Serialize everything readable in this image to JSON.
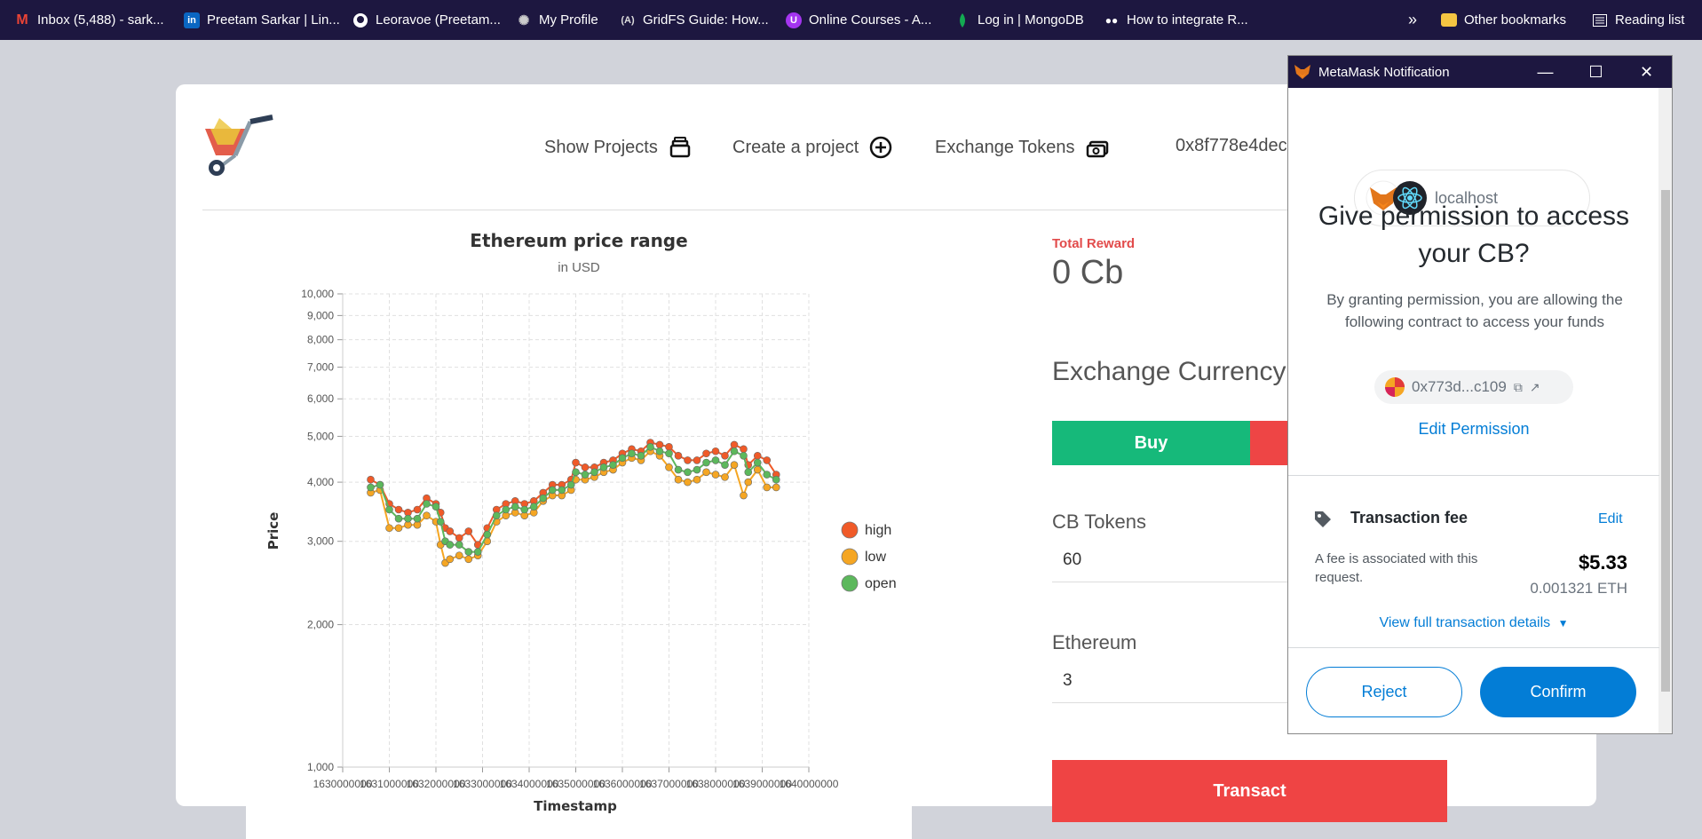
{
  "bookmarks": {
    "items": [
      {
        "label": "Inbox (5,488) - sark...",
        "icon": "gmail-icon",
        "color": "#ea4335"
      },
      {
        "label": "Preetam Sarkar | Lin...",
        "icon": "linkedin-icon",
        "color": "#0a66c2"
      },
      {
        "label": "Leoravoe (Preetam...",
        "icon": "github-icon",
        "color": "#ffffff"
      },
      {
        "label": "My Profile",
        "icon": "profile-icon",
        "color": "#cccccc"
      },
      {
        "label": "GridFS Guide: How...",
        "icon": "gridfs-icon",
        "color": "#dddddd"
      },
      {
        "label": "Online Courses - A...",
        "icon": "udemy-icon",
        "color": "#a435f0"
      },
      {
        "label": "Log in | MongoDB",
        "icon": "mongodb-leaf-icon",
        "color": "#13aa52"
      },
      {
        "label": "How to integrate R...",
        "icon": "medium-icon",
        "color": "#ffffff"
      }
    ],
    "overflow": "»",
    "other_bookmarks": "Other bookmarks",
    "reading_list": "Reading list"
  },
  "nav": {
    "show_projects": "Show Projects",
    "create_project": "Create a project",
    "exchange_tokens": "Exchange Tokens",
    "account": "0x8f778e4dec"
  },
  "chart_data": {
    "type": "line",
    "title": "Ethereum price range",
    "subtitle": "in USD",
    "xlabel": "Timestamp",
    "ylabel": "Price",
    "yscale": "log",
    "ylim": [
      1000,
      10000
    ],
    "xlim": [
      1630000000,
      1640000000
    ],
    "y_ticks": [
      "1,000",
      "2,000",
      "3,000",
      "4,000",
      "5,000",
      "6,000",
      "7,000",
      "8,000",
      "9,000",
      "10,000"
    ],
    "x_ticks": [
      "1630000000",
      "1631000000",
      "1632000000",
      "1633000000",
      "1634000000",
      "1635000000",
      "1636000000",
      "1637000000",
      "1638000000",
      "1639000000",
      "1640000000"
    ],
    "legend_position": "right",
    "grid": true,
    "series": [
      {
        "name": "high",
        "color": "#f05a28",
        "values": [
          [
            1630600000,
            4050
          ],
          [
            1630800000,
            3950
          ],
          [
            1631000000,
            3600
          ],
          [
            1631200000,
            3500
          ],
          [
            1631400000,
            3450
          ],
          [
            1631600000,
            3500
          ],
          [
            1631800000,
            3700
          ],
          [
            1632000000,
            3600
          ],
          [
            1632100000,
            3450
          ],
          [
            1632200000,
            3200
          ],
          [
            1632300000,
            3150
          ],
          [
            1632500000,
            3050
          ],
          [
            1632700000,
            3150
          ],
          [
            1632900000,
            2950
          ],
          [
            1633100000,
            3200
          ],
          [
            1633300000,
            3500
          ],
          [
            1633500000,
            3600
          ],
          [
            1633700000,
            3650
          ],
          [
            1633900000,
            3600
          ],
          [
            1634100000,
            3650
          ],
          [
            1634300000,
            3800
          ],
          [
            1634500000,
            3950
          ],
          [
            1634700000,
            3950
          ],
          [
            1634900000,
            4050
          ],
          [
            1635000000,
            4400
          ],
          [
            1635200000,
            4300
          ],
          [
            1635400000,
            4300
          ],
          [
            1635600000,
            4400
          ],
          [
            1635800000,
            4450
          ],
          [
            1636000000,
            4600
          ],
          [
            1636200000,
            4700
          ],
          [
            1636400000,
            4650
          ],
          [
            1636600000,
            4850
          ],
          [
            1636800000,
            4800
          ],
          [
            1637000000,
            4750
          ],
          [
            1637200000,
            4550
          ],
          [
            1637400000,
            4450
          ],
          [
            1637600000,
            4450
          ],
          [
            1637800000,
            4600
          ],
          [
            1638000000,
            4650
          ],
          [
            1638200000,
            4550
          ],
          [
            1638400000,
            4800
          ],
          [
            1638600000,
            4700
          ],
          [
            1638700000,
            4350
          ],
          [
            1638900000,
            4550
          ],
          [
            1639100000,
            4450
          ],
          [
            1639300000,
            4150
          ]
        ]
      },
      {
        "name": "low",
        "color": "#f5a623",
        "values": [
          [
            1630600000,
            3800
          ],
          [
            1630800000,
            3850
          ],
          [
            1631000000,
            3200
          ],
          [
            1631200000,
            3200
          ],
          [
            1631400000,
            3250
          ],
          [
            1631600000,
            3250
          ],
          [
            1631800000,
            3400
          ],
          [
            1632000000,
            3300
          ],
          [
            1632100000,
            2950
          ],
          [
            1632200000,
            2700
          ],
          [
            1632300000,
            2750
          ],
          [
            1632500000,
            2800
          ],
          [
            1632700000,
            2750
          ],
          [
            1632900000,
            2800
          ],
          [
            1633100000,
            3000
          ],
          [
            1633300000,
            3300
          ],
          [
            1633500000,
            3400
          ],
          [
            1633700000,
            3450
          ],
          [
            1633900000,
            3400
          ],
          [
            1634100000,
            3450
          ],
          [
            1634300000,
            3650
          ],
          [
            1634500000,
            3750
          ],
          [
            1634700000,
            3750
          ],
          [
            1634900000,
            3850
          ],
          [
            1635000000,
            4050
          ],
          [
            1635200000,
            4050
          ],
          [
            1635400000,
            4100
          ],
          [
            1635600000,
            4200
          ],
          [
            1635800000,
            4250
          ],
          [
            1636000000,
            4400
          ],
          [
            1636200000,
            4500
          ],
          [
            1636400000,
            4450
          ],
          [
            1636600000,
            4650
          ],
          [
            1636800000,
            4550
          ],
          [
            1637000000,
            4300
          ],
          [
            1637200000,
            4050
          ],
          [
            1637400000,
            4000
          ],
          [
            1637600000,
            4050
          ],
          [
            1637800000,
            4200
          ],
          [
            1638000000,
            4150
          ],
          [
            1638200000,
            4100
          ],
          [
            1638400000,
            4350
          ],
          [
            1638600000,
            3750
          ],
          [
            1638700000,
            4000
          ],
          [
            1638900000,
            4250
          ],
          [
            1639100000,
            3900
          ],
          [
            1639300000,
            3900
          ]
        ]
      },
      {
        "name": "open",
        "color": "#5cb85c",
        "values": [
          [
            1630600000,
            3900
          ],
          [
            1630800000,
            3950
          ],
          [
            1631000000,
            3500
          ],
          [
            1631200000,
            3350
          ],
          [
            1631400000,
            3350
          ],
          [
            1631600000,
            3350
          ],
          [
            1631800000,
            3600
          ],
          [
            1632000000,
            3550
          ],
          [
            1632100000,
            3300
          ],
          [
            1632200000,
            3000
          ],
          [
            1632300000,
            2950
          ],
          [
            1632500000,
            2950
          ],
          [
            1632700000,
            2850
          ],
          [
            1632900000,
            2850
          ],
          [
            1633100000,
            3100
          ],
          [
            1633300000,
            3400
          ],
          [
            1633500000,
            3500
          ],
          [
            1633700000,
            3550
          ],
          [
            1633900000,
            3500
          ],
          [
            1634100000,
            3550
          ],
          [
            1634300000,
            3700
          ],
          [
            1634500000,
            3850
          ],
          [
            1634700000,
            3850
          ],
          [
            1634900000,
            3950
          ],
          [
            1635000000,
            4200
          ],
          [
            1635200000,
            4150
          ],
          [
            1635400000,
            4200
          ],
          [
            1635600000,
            4300
          ],
          [
            1635800000,
            4350
          ],
          [
            1636000000,
            4500
          ],
          [
            1636200000,
            4600
          ],
          [
            1636400000,
            4550
          ],
          [
            1636600000,
            4750
          ],
          [
            1636800000,
            4650
          ],
          [
            1637000000,
            4600
          ],
          [
            1637200000,
            4250
          ],
          [
            1637400000,
            4200
          ],
          [
            1637600000,
            4250
          ],
          [
            1637800000,
            4400
          ],
          [
            1638000000,
            4450
          ],
          [
            1638200000,
            4350
          ],
          [
            1638400000,
            4650
          ],
          [
            1638600000,
            4550
          ],
          [
            1638700000,
            4200
          ],
          [
            1638900000,
            4400
          ],
          [
            1639100000,
            4150
          ],
          [
            1639300000,
            4050
          ]
        ]
      }
    ]
  },
  "reward": {
    "label": "Total Reward",
    "value": "0 Cb"
  },
  "exchange": {
    "title": "Exchange Currency",
    "buy_label": "Buy",
    "cb_label": "CB Tokens",
    "cb_value": "60",
    "eth_label": "Ethereum",
    "eth_value": "3",
    "transact_label": "Transact"
  },
  "metamask": {
    "window_title": "MetaMask Notification",
    "site": "localhost",
    "heading": "Give permission to access your CB?",
    "description": "By granting permission, you are allowing the following contract to access your funds",
    "contract_address": "0x773d...c109",
    "edit_permission": "Edit Permission",
    "fee_title": "Transaction fee",
    "fee_edit": "Edit",
    "fee_desc": "A fee is associated with this request.",
    "fee_usd": "$5.33",
    "fee_eth": "0.001321 ETH",
    "view_details": "View full transaction details",
    "reject": "Reject",
    "confirm": "Confirm"
  }
}
